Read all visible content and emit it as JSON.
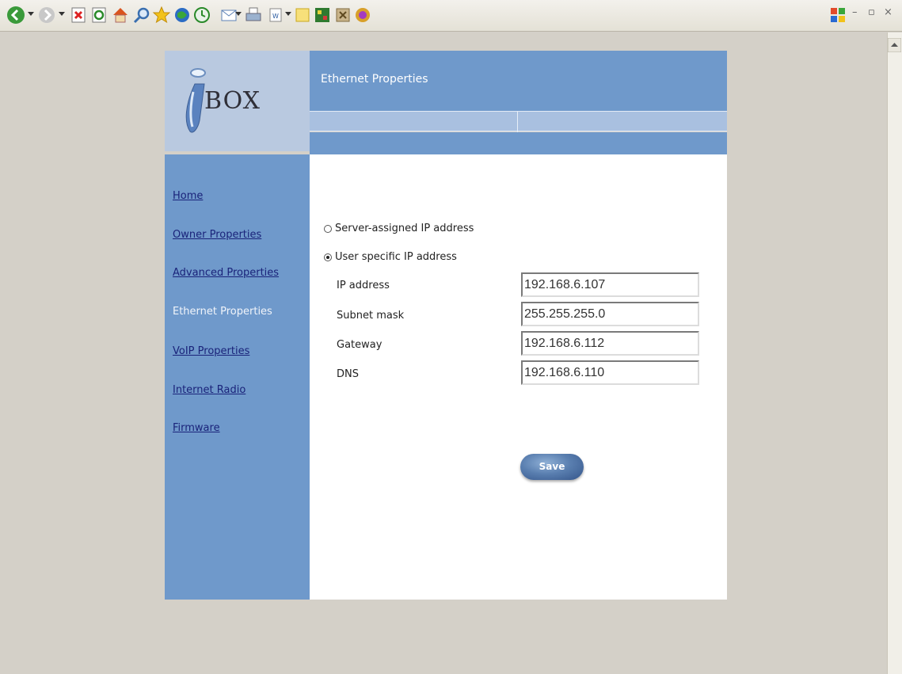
{
  "toolbar": {
    "icons": [
      "back-icon",
      "forward-icon",
      "stop-icon",
      "refresh-icon",
      "home-icon",
      "search-icon",
      "favorites-icon",
      "media-icon",
      "history-icon",
      "mail-icon",
      "print-icon",
      "edit-icon",
      "messenger-icon",
      "tool-icon",
      "research-icon",
      "extension-icon"
    ],
    "window_controls": [
      "–",
      "▫",
      "×"
    ]
  },
  "logo": {
    "text": "BOX"
  },
  "header": {
    "title": "Ethernet Properties"
  },
  "sidebar": {
    "items": [
      {
        "label": "Home",
        "active": false
      },
      {
        "label": "Owner Properties",
        "active": false
      },
      {
        "label": "Advanced Properties",
        "active": false
      },
      {
        "label": "Ethernet Properties",
        "active": true
      },
      {
        "label": "VoIP Properties",
        "active": false
      },
      {
        "label": "Internet Radio",
        "active": false
      },
      {
        "label": "Firmware",
        "active": false
      }
    ]
  },
  "form": {
    "radio_server": {
      "label": "Server-assigned IP address",
      "checked": false
    },
    "radio_user": {
      "label": "User specific IP address",
      "checked": true
    },
    "fields": [
      {
        "label": "IP address",
        "value": "192.168.6.107"
      },
      {
        "label": "Subnet mask",
        "value": "255.255.255.0"
      },
      {
        "label": "Gateway",
        "value": "192.168.6.112"
      },
      {
        "label": "DNS",
        "value": "192.168.6.110"
      }
    ],
    "save_label": "Save"
  },
  "colors": {
    "panel_blue": "#6f99cb",
    "logo_bg": "#b9c9e0",
    "subbar": "#a9c0e0",
    "nav_link": "#1a237a"
  }
}
